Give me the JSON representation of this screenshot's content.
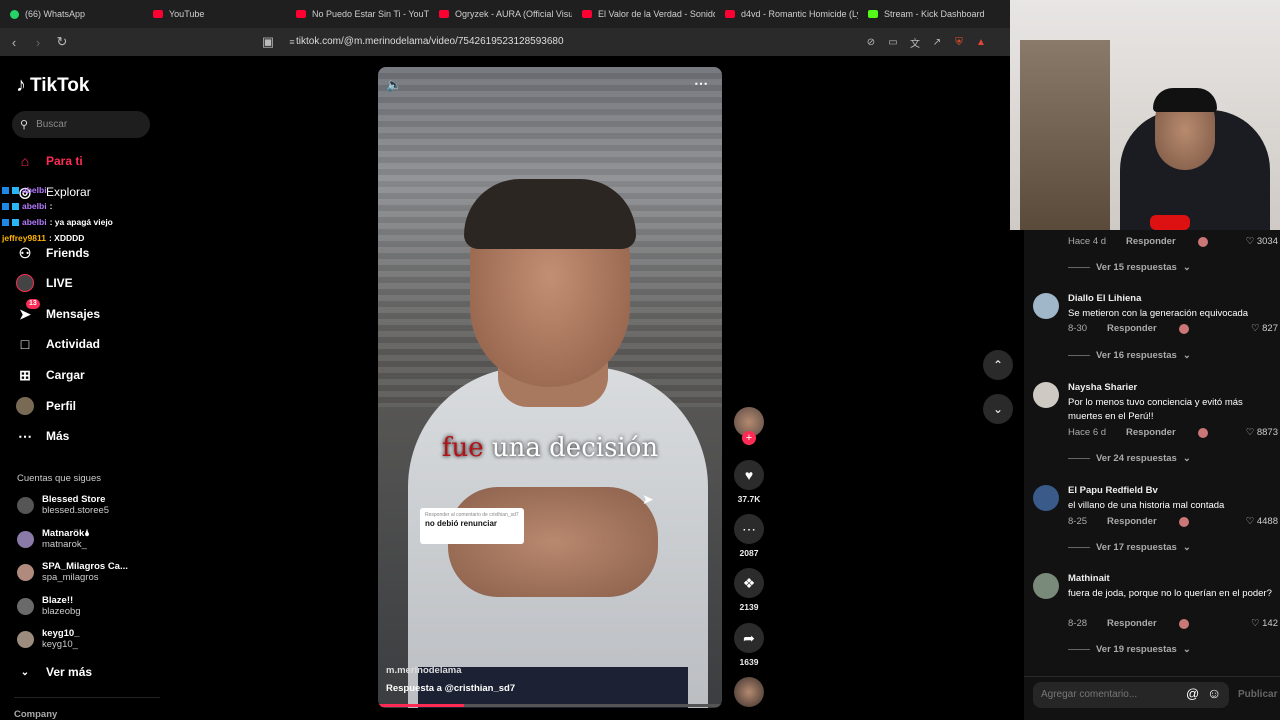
{
  "browser": {
    "tabs": [
      {
        "label": "(66) WhatsApp",
        "color": "#25d366"
      },
      {
        "label": "YouTube",
        "color": "#ff0033"
      },
      {
        "label": "No Puedo Estar Sin Ti - YouTub",
        "color": "#ff0033"
      },
      {
        "label": "Ogryzek - AURA (Official Visua",
        "color": "#ff0033"
      },
      {
        "label": "El Valor de la Verdad - Sonido",
        "color": "#ff0033"
      },
      {
        "label": "d4vd - Romantic Homicide (Lyr",
        "color": "#ff0033"
      },
      {
        "label": "Stream - Kick Dashboard",
        "color": "#53fc18"
      }
    ],
    "url": "tiktok.com/@m.merinodelama/video/7542619523128593680"
  },
  "sidebar": {
    "logo": "TikTok",
    "search_placeholder": "Buscar",
    "nav": [
      {
        "label": "Para ti",
        "icon": "home-icon",
        "active": true
      },
      {
        "label": "Explorar",
        "icon": "compass-icon"
      },
      {
        "label": "Friends",
        "icon": "friends-icon"
      },
      {
        "label": "LIVE",
        "icon": "live-icon"
      },
      {
        "label": "Mensajes",
        "icon": "messages-icon",
        "badge": "13"
      },
      {
        "label": "Actividad",
        "icon": "activity-icon"
      },
      {
        "label": "Cargar",
        "icon": "upload-icon"
      },
      {
        "label": "Perfil",
        "icon": "profile-icon"
      },
      {
        "label": "Más",
        "icon": "more-icon"
      }
    ],
    "following_title": "Cuentas que sigues",
    "following": [
      {
        "name": "Blessed Store",
        "handle": "blessed.storee5"
      },
      {
        "name": "Matnarök🌢",
        "handle": "matnarok_"
      },
      {
        "name": "SPA_Milagros Ca...",
        "handle": "spa_milagros"
      },
      {
        "name": "Blaze!!",
        "handle": "blazeobg"
      },
      {
        "name": "keyg10_",
        "handle": "keyg10_"
      }
    ],
    "see_more": "Ver más",
    "company": "Company"
  },
  "chat_overlay": [
    {
      "user": "abelbi",
      "msg": ""
    },
    {
      "user": "abelbi",
      "msg": ":"
    },
    {
      "user": "abelbi",
      "msg": ": ya apagá viejo"
    },
    {
      "user": "jeffrey9811",
      "msg": ": XDDDD"
    }
  ],
  "video": {
    "caption_red": "fue",
    "caption_rest": " una decisión",
    "sticker_small": "Responder al comentario de cristhian_sd7",
    "sticker_main": "no debió renunciar",
    "username": "m.merinodelama",
    "description": "Respuesta a @cristhian_sd7",
    "progress": 0.25
  },
  "actions": {
    "likes": "37.7K",
    "comments": "2087",
    "saves": "2139",
    "shares": "1639"
  },
  "comments": {
    "first_meta": {
      "time": "Hace 4 d",
      "reply": "Responder",
      "likes": "3034",
      "see_more": "Ver 15 respuestas"
    },
    "items": [
      {
        "name": "Diallo El Lihiena",
        "text": "Se metieron con la generación equivocada",
        "time": "8-30",
        "reply": "Responder",
        "likes": "827",
        "see_more": "Ver 16 respuestas"
      },
      {
        "name": "Naysha Sharier",
        "text": "Por lo menos tuvo conciencia y evitó más muertes en el Perú!!",
        "time": "Hace 6 d",
        "reply": "Responder",
        "likes": "8873",
        "see_more": "Ver 24 respuestas"
      },
      {
        "name": "El Papu Redfield Bv",
        "text": "el villano de una historia mal contada",
        "time": "8-25",
        "reply": "Responder",
        "likes": "4488",
        "see_more": "Ver 17 respuestas"
      },
      {
        "name": "Mathinait",
        "text": "fuera de joda, porque no lo querían en el poder?",
        "time": "8-28",
        "reply": "Responder",
        "likes": "142",
        "see_more": "Ver 19 respuestas"
      }
    ],
    "input_placeholder": "Agregar comentario...",
    "publish": "Publicar"
  },
  "colors": {
    "accent": "#fe2c55"
  }
}
